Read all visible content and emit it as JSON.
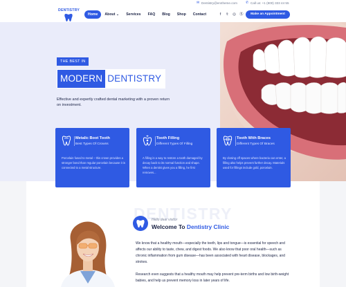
{
  "topbar": {
    "email": "Dentistry@erxtheme.com",
    "phone": "Call us: +1 (800) 333 44 55",
    "email_icon": "envelope-icon",
    "phone_icon": "phone-icon"
  },
  "header": {
    "logo_text": "DENTISTRY",
    "nav": [
      "Home",
      "About",
      "Services",
      "FAQ",
      "Blog",
      "Shop",
      "Contact"
    ],
    "active_nav": "Home",
    "social_icons": [
      "facebook-icon",
      "twitter-icon",
      "instagram-icon",
      "skype-icon"
    ],
    "appointment_label": "Make an Appointment"
  },
  "hero": {
    "eyebrow": "THE BEST IN",
    "headline_part1": "MODERN",
    "headline_part2": "DENTISTRY",
    "subtext": "Effective and expertly crafted dental marketing with a proven return on investment."
  },
  "cards": [
    {
      "icon": "tooth-crown-icon",
      "title": "Metalic Boot Tooth",
      "subtitle": "Best Types Of Crowns",
      "body": "Porcelain fused to metal – this crown provides a stronger bond than regular porcelain because it is connected to a metal structure."
    },
    {
      "icon": "tooth-filling-icon",
      "title": "Tooth Filling",
      "subtitle": "Different Types Of Filling",
      "body": "A filling is a way to restore a tooth damaged by decay back to its normal function and shape. When a dentist gives you a filling, he first removes..."
    },
    {
      "icon": "tooth-braces-icon",
      "title": "Tooth With Braces",
      "subtitle": "Different Types Of Braces",
      "body": "By closing off spaces where bacteria can enter, a filling also helps prevent further decay. Materials used for fillings include gold, porcelain."
    }
  ],
  "about": {
    "ghost_word": "DENTISTRY",
    "hello": "Hello dear visitor",
    "title_prefix": "Welcome To ",
    "title_highlight": "Dentistry Clinic",
    "badge_icon": "tooth-icon",
    "p1": "We know that a healthy mouth—especially the teeth, lips and tongue—is essential for speech and affects our ability to taste, chew, and digest foods. We also know that poor oral health—such as chronic inflammation from gum disease—has been associated with heart disease, blockages, and strokes.",
    "p2": "Research even suggests that a healthy mouth may help prevent pre-term births and low birth-weight babies, and help us prevent memory loss in later years of life."
  },
  "colors": {
    "accent": "#2f5ae3",
    "hero_bg": "#eaecfa",
    "text_dark": "#1b2345"
  }
}
